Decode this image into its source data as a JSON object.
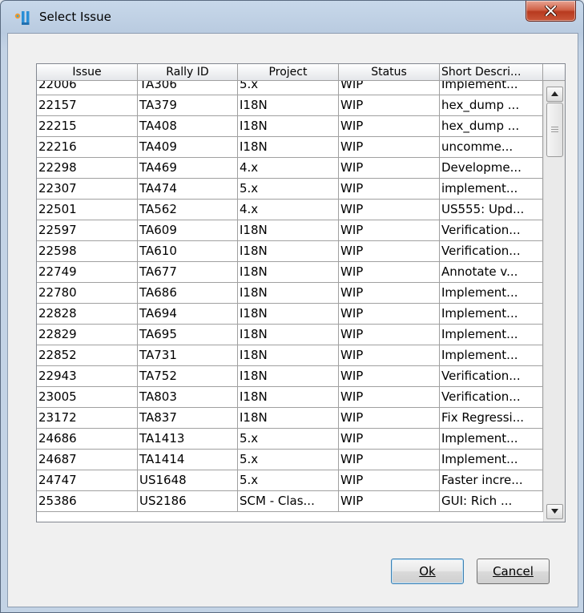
{
  "window": {
    "title": "Select Issue",
    "icon": "jetbrains-app-icon",
    "close_icon": "close-x-icon"
  },
  "table": {
    "columns": [
      "Issue",
      "Rally ID",
      "Project",
      "Status",
      "Short Descri..."
    ],
    "rows": [
      [
        "22006",
        "TA306",
        "5.x",
        "WIP",
        "Implement..."
      ],
      [
        "22157",
        "TA379",
        "I18N",
        "WIP",
        "hex_dump ..."
      ],
      [
        "22215",
        "TA408",
        "I18N",
        "WIP",
        "hex_dump ..."
      ],
      [
        "22216",
        "TA409",
        "I18N",
        "WIP",
        "uncomme..."
      ],
      [
        "22298",
        "TA469",
        "4.x",
        "WIP",
        "Developme..."
      ],
      [
        "22307",
        "TA474",
        "5.x",
        "WIP",
        "implement..."
      ],
      [
        "22501",
        "TA562",
        "4.x",
        "WIP",
        "US555: Upd..."
      ],
      [
        "22597",
        "TA609",
        "I18N",
        "WIP",
        "Verification..."
      ],
      [
        "22598",
        "TA610",
        "I18N",
        "WIP",
        "Verification..."
      ],
      [
        "22749",
        "TA677",
        "I18N",
        "WIP",
        "Annotate v..."
      ],
      [
        "22780",
        "TA686",
        "I18N",
        "WIP",
        "Implement..."
      ],
      [
        "22828",
        "TA694",
        "I18N",
        "WIP",
        "Implement..."
      ],
      [
        "22829",
        "TA695",
        "I18N",
        "WIP",
        "Implement..."
      ],
      [
        "22852",
        "TA731",
        "I18N",
        "WIP",
        "Implement..."
      ],
      [
        "22943",
        "TA752",
        "I18N",
        "WIP",
        "Verification..."
      ],
      [
        "23005",
        "TA803",
        "I18N",
        "WIP",
        "Verification..."
      ],
      [
        "23172",
        "TA837",
        "I18N",
        "WIP",
        "Fix Regressi..."
      ],
      [
        "24686",
        "TA1413",
        "5.x",
        "WIP",
        "Implement..."
      ],
      [
        "24687",
        "TA1414",
        "5.x",
        "WIP",
        "Implement..."
      ],
      [
        "24747",
        "US1648",
        "5.x",
        "WIP",
        "Faster incre..."
      ],
      [
        "25386",
        "US2186",
        "SCM - Clas...",
        "WIP",
        "GUI:  Rich ..."
      ]
    ]
  },
  "buttons": {
    "ok_label": "Ok",
    "cancel_label": "Cancel"
  },
  "colors": {
    "title_bar": "#c3d3e5",
    "close_button": "#c9573a",
    "grid_lines": "#a0a0a0"
  }
}
